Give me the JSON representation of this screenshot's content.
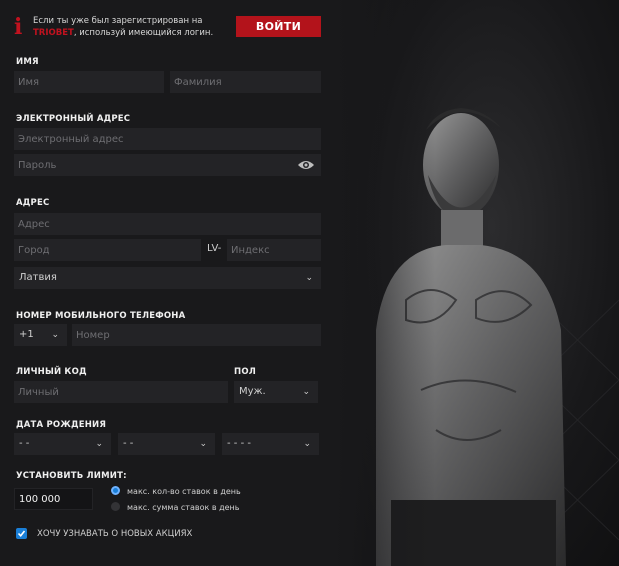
{
  "notice": {
    "line1": "Если ты уже был зарегистрирован на",
    "brand": "TRIOBET",
    "line2": ", используй имеющийся логин.",
    "login_button": "ВОЙТИ"
  },
  "name_section": {
    "label": "ИМЯ",
    "first_placeholder": "Имя",
    "last_placeholder": "Фамилия"
  },
  "email_section": {
    "label": "ЭЛЕКТРОННЫЙ АДРЕС",
    "email_placeholder": "Электронный адрес",
    "password_placeholder": "Пароль",
    "eye_icon": "eye-icon"
  },
  "address_section": {
    "label": "АДРЕС",
    "address_placeholder": "Адрес",
    "city_placeholder": "Город",
    "postal_prefix": "LV-",
    "postal_placeholder": "Индекс",
    "country_value": "Латвия"
  },
  "phone_section": {
    "label": "НОМЕР МОБИЛЬНОГО ТЕЛЕФОНА",
    "code_value": "+1",
    "number_placeholder": "Номер"
  },
  "personal_section": {
    "label": "ЛИЧНЫЙ КОД",
    "code_placeholder": "Личный",
    "gender_label": "ПОЛ",
    "gender_value": "Муж."
  },
  "birth_section": {
    "label": "ДАТА РОЖДЕНИЯ",
    "day_value": "- -",
    "month_value": "- -",
    "year_value": "- - - -"
  },
  "limit_section": {
    "label": "УСТАНОВИТЬ ЛИМИТ:",
    "value": "100 000",
    "option1": "макс. кол-во ставок в день",
    "option2": "макс. сумма ставок в день",
    "selected": "option1"
  },
  "promo": {
    "label": "ХОЧУ УЗНАВАТЬ О НОВЫХ АКЦИЯХ",
    "checked": true
  },
  "colors": {
    "accent_red": "#b3131b",
    "accent_blue": "#1a7fd8",
    "field_bg": "#232326"
  }
}
